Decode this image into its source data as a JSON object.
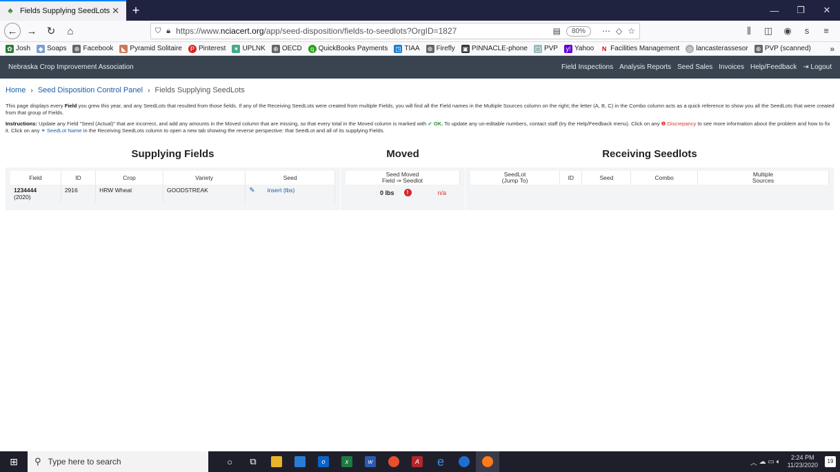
{
  "browser": {
    "tab_title": "Fields Supplying SeedLots",
    "url_prefix": "https://www.",
    "url_domain": "nciacert.org",
    "url_path": "/app/seed-disposition/fields-to-seedlots?OrgID=1827",
    "zoom": "80%",
    "bookmarks": [
      "Josh",
      "Soaps",
      "Facebook",
      "Pyramid Solitaire",
      "Pinterest",
      "UPLNK",
      "OECD",
      "QuickBooks Payments",
      "TIAA",
      "Firefly",
      "PINNACLE-phone",
      "PVP",
      "Yahoo",
      "Facilities Management",
      "lancasterassesor",
      "PVP (scanned)"
    ]
  },
  "app": {
    "brand": "Nebraska Crop Improvement Association",
    "menu": [
      "Field Inspections",
      "Analysis Reports",
      "Seed Sales",
      "Invoices",
      "Help/Feedback",
      "Logout"
    ]
  },
  "breadcrumb": {
    "home": "Home",
    "panel": "Seed Disposition Control Panel",
    "current": "Fields Supplying SeedLots"
  },
  "intro": {
    "p1a": "This page displays every ",
    "p1b": "Field",
    "p1c": " you grew this year, and any SeedLots that resulted from those fields. If any of the Receiving SeedLots were created from multiple Fields, you will find all the Field names in the Multiple Sources column on the right; the letter (A, B, C) in the Combo column acts as a quick reference to show you all the SeedLots that were created from that group of Fields.",
    "p2a": "Instructions:",
    "p2b": " Update any Field \"Seed (Actual)\" that are incorrect, and add any amounts in the Moved column that are missing, so that every total in the Moved column is marked with ",
    "p2ok": "OK.",
    "p2c": " To update any un-editable numbers, contact staff (try the Help/Feedback menu). Click on any ",
    "p2disc": "Discrepancy",
    "p2d": " to see more information about the problem and how to fix it. Click on any ",
    "p2link": "SeedLot Name",
    "p2e": " in the Receiving SeedLots column to open a new tab showing the reverse perspective: that SeedLot and all of its supplying Fields."
  },
  "supplying": {
    "heading": "Supplying Fields",
    "headers": [
      "Field",
      "ID",
      "Crop",
      "Variety",
      "Seed"
    ],
    "row": {
      "field": "1234444",
      "year": "(2020)",
      "id": "2916",
      "crop": "HRW Wheat",
      "variety": "GOODSTREAK",
      "seed": "insert (lbs)"
    }
  },
  "moved": {
    "heading": "Moved",
    "header1": "Seed Moved",
    "header2": "Field ⇒ Seedlot",
    "value": "0 lbs",
    "status": "n/a"
  },
  "receiving": {
    "heading": "Receiving Seedlots",
    "h_seedlot1": "SeedLot",
    "h_seedlot2": "(Jump To)",
    "h_id": "ID",
    "h_seed": "Seed",
    "h_combo": "Combo",
    "h_multi1": "Multiple",
    "h_multi2": "Sources"
  },
  "taskbar": {
    "search_placeholder": "Type here to search",
    "time": "2:24 PM",
    "date": "11/23/2020",
    "notif": "19"
  }
}
